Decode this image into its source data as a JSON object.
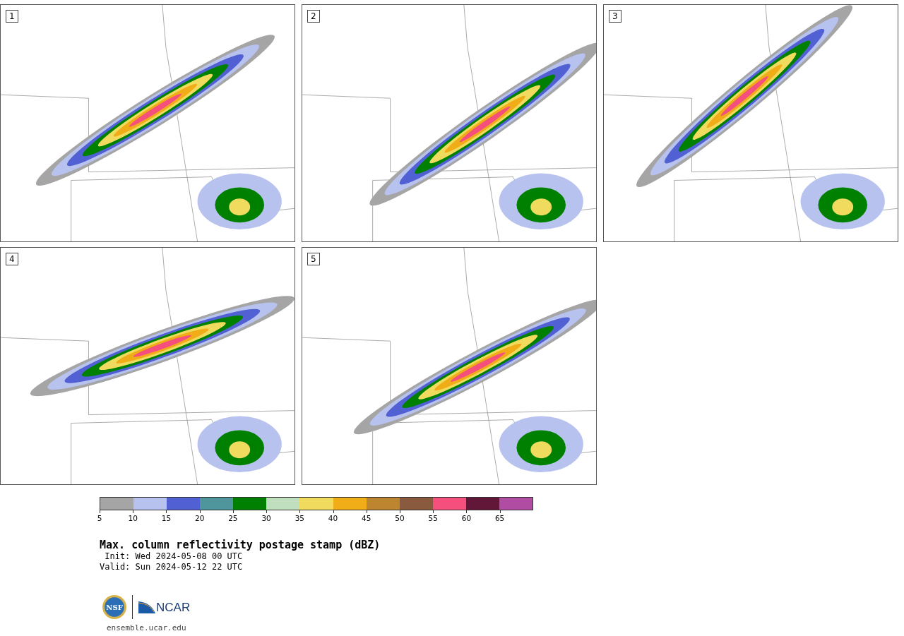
{
  "panels": [
    {
      "label": "1"
    },
    {
      "label": "2"
    },
    {
      "label": "3"
    },
    {
      "label": "4"
    },
    {
      "label": "5"
    }
  ],
  "colorbar": {
    "bins": [
      {
        "color": "#a5a5a5"
      },
      {
        "color": "#b8c2ee"
      },
      {
        "color": "#5161d4"
      },
      {
        "color": "#4f969c"
      },
      {
        "color": "#008000"
      },
      {
        "color": "#bfdfbf"
      },
      {
        "color": "#f0db5e"
      },
      {
        "color": "#f0ad17"
      },
      {
        "color": "#bd8530"
      },
      {
        "color": "#8a5a3e"
      },
      {
        "color": "#f5507d"
      },
      {
        "color": "#621738"
      },
      {
        "color": "#b04ca2"
      }
    ],
    "ticks": [
      "5",
      "10",
      "15",
      "20",
      "25",
      "30",
      "35",
      "40",
      "45",
      "50",
      "55",
      "60",
      "65"
    ]
  },
  "title": "Max. column reflectivity postage stamp (dBZ)",
  "init": " Init: Wed 2024-05-08 00 UTC",
  "valid": "Valid: Sun 2024-05-12 22 UTC",
  "logo": {
    "nsf": "NSF",
    "ncar": "NCAR"
  },
  "site": "ensemble.ucar.edu"
}
